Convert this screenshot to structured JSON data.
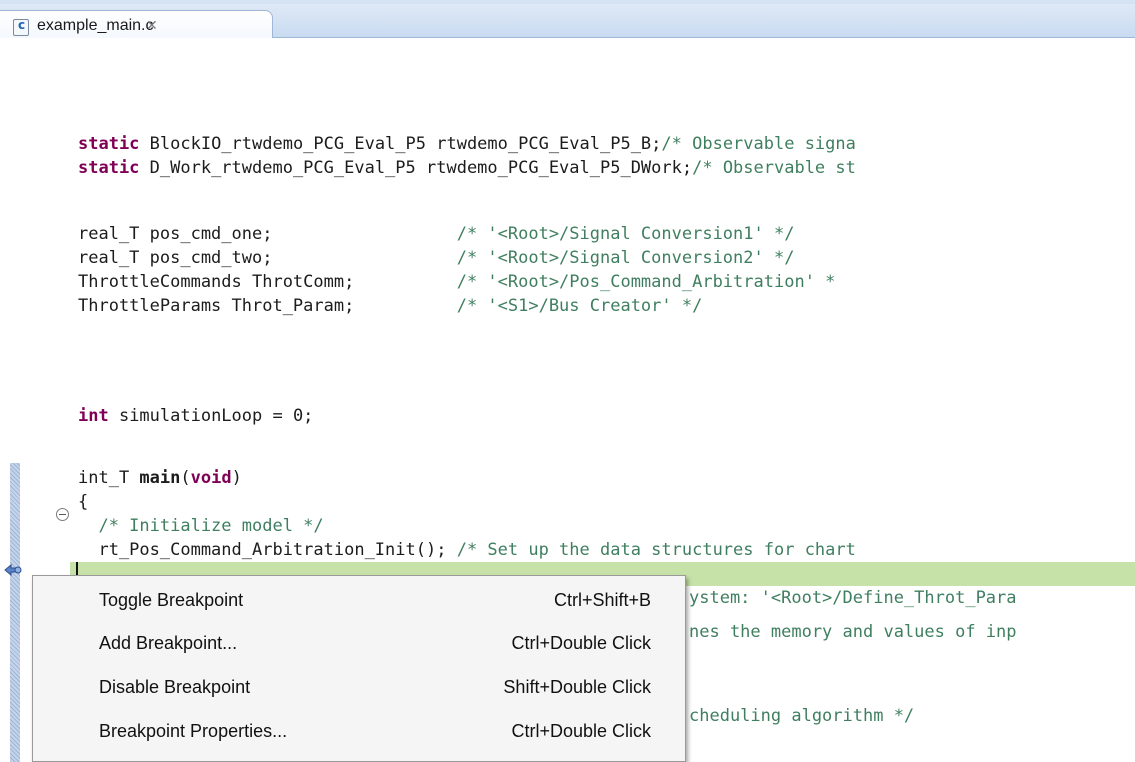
{
  "tab": {
    "title": "example_main.c",
    "close_glyph": "✕"
  },
  "code": {
    "line1": {
      "kw": "static",
      "text": " BlockIO_rtwdemo_PCG_Eval_P5 rtwdemo_PCG_Eval_P5_B;",
      "comment": "/* Observable signa"
    },
    "line2": {
      "kw": "static",
      "text": " D_Work_rtwdemo_PCG_Eval_P5 rtwdemo_PCG_Eval_P5_DWork;",
      "comment": "/* Observable st"
    },
    "line3": {
      "text": "real_T pos_cmd_one;                  ",
      "comment": "/* '<Root>/Signal Conversion1' */"
    },
    "line4": {
      "text": "real_T pos_cmd_two;                  ",
      "comment": "/* '<Root>/Signal Conversion2' */"
    },
    "line5": {
      "text": "ThrottleCommands ThrotComm;          ",
      "comment": "/* '<Root>/Pos_Command_Arbitration' *"
    },
    "line6": {
      "text": "ThrottleParams Throt_Param;          ",
      "comment": "/* '<S1>/Bus Creator' */"
    },
    "line7": {
      "kw": "int",
      "text": " simulationLoop = 0;"
    },
    "line8": {
      "text": "int_T ",
      "fn": "main",
      "paren_open": "(",
      "kw": "void",
      "paren_close": ")"
    },
    "line9": {
      "text": "{"
    },
    "line10": {
      "comment": "  /* Initialize model */"
    },
    "line11": {
      "text": "  rt_Pos_Command_Arbitration_Init(); ",
      "comment": "/* Set up the data structures for chart"
    },
    "line12": {
      "comment": "ystem: '<Root>/Define_Throt_Para"
    },
    "line13": {
      "comment": "nes the memory and values of inp"
    },
    "line14": {
      "comment": "cheduling algorithm */"
    }
  },
  "context_menu": {
    "items": [
      {
        "label": "Toggle Breakpoint",
        "shortcut": "Ctrl+Shift+B"
      },
      {
        "label": "Add Breakpoint...",
        "shortcut": "Ctrl+Double Click"
      },
      {
        "label": "Disable Breakpoint",
        "shortcut": "Shift+Double Click"
      },
      {
        "label": "Breakpoint Properties...",
        "shortcut": "Ctrl+Double Click"
      }
    ]
  }
}
